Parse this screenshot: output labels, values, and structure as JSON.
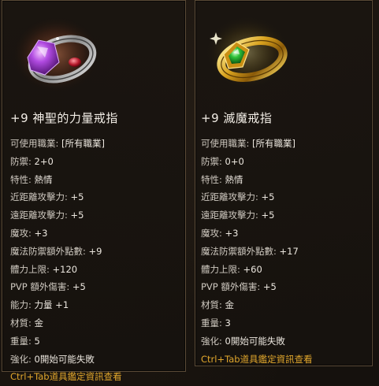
{
  "items": [
    {
      "name": "+9 神聖的力量戒指",
      "stats": [
        {
          "label": "可使用職業: ",
          "value": "[所有職業]"
        },
        {
          "label": "防禦: ",
          "value": "2+0"
        },
        {
          "label": "特性: ",
          "value": "熱情"
        },
        {
          "label": "近距離攻擊力: ",
          "value": "+5"
        },
        {
          "label": "遠距離攻擊力: ",
          "value": "+5"
        },
        {
          "label": "魔攻: ",
          "value": "+3"
        },
        {
          "label": "魔法防禦額外點數: ",
          "value": "+9"
        },
        {
          "label": "體力上限: ",
          "value": "+120"
        },
        {
          "label": "PVP 額外傷害: ",
          "value": "+5"
        },
        {
          "label": "能力: ",
          "value": "力量 +1"
        },
        {
          "label": "材質: ",
          "value": "金"
        },
        {
          "label": "重量: ",
          "value": "5"
        },
        {
          "label": "強化: ",
          "value": "0開始可能失敗"
        }
      ],
      "hint": "Ctrl+Tab道具鑑定資訊查看"
    },
    {
      "name": "+9 滅魔戒指",
      "stats": [
        {
          "label": "可使用職業: ",
          "value": "[所有職業]"
        },
        {
          "label": "防禦: ",
          "value": "0+0"
        },
        {
          "label": "特性: ",
          "value": "熱情"
        },
        {
          "label": "近距離攻擊力: ",
          "value": "+5"
        },
        {
          "label": "遠距離攻擊力: ",
          "value": "+5"
        },
        {
          "label": "魔攻: ",
          "value": "+3"
        },
        {
          "label": "魔法防禦額外點數: ",
          "value": "+17"
        },
        {
          "label": "體力上限: ",
          "value": "+60"
        },
        {
          "label": "PVP 額外傷害: ",
          "value": "+5"
        },
        {
          "label": "材質: ",
          "value": "金"
        },
        {
          "label": "重量: ",
          "value": "3"
        },
        {
          "label": "強化: ",
          "value": "0開始可能失敗"
        }
      ],
      "hint": "Ctrl+Tab道具鑑定資訊查看"
    }
  ],
  "icons": [
    "purple-gem-ring-icon",
    "green-gem-gold-ring-icon"
  ],
  "colors": {
    "background": "#17120d",
    "panel_border": "#5a4a36",
    "name_text": "#f2ede6",
    "stat_text": "#cfc9c0",
    "hint_text": "#e0a62c"
  }
}
